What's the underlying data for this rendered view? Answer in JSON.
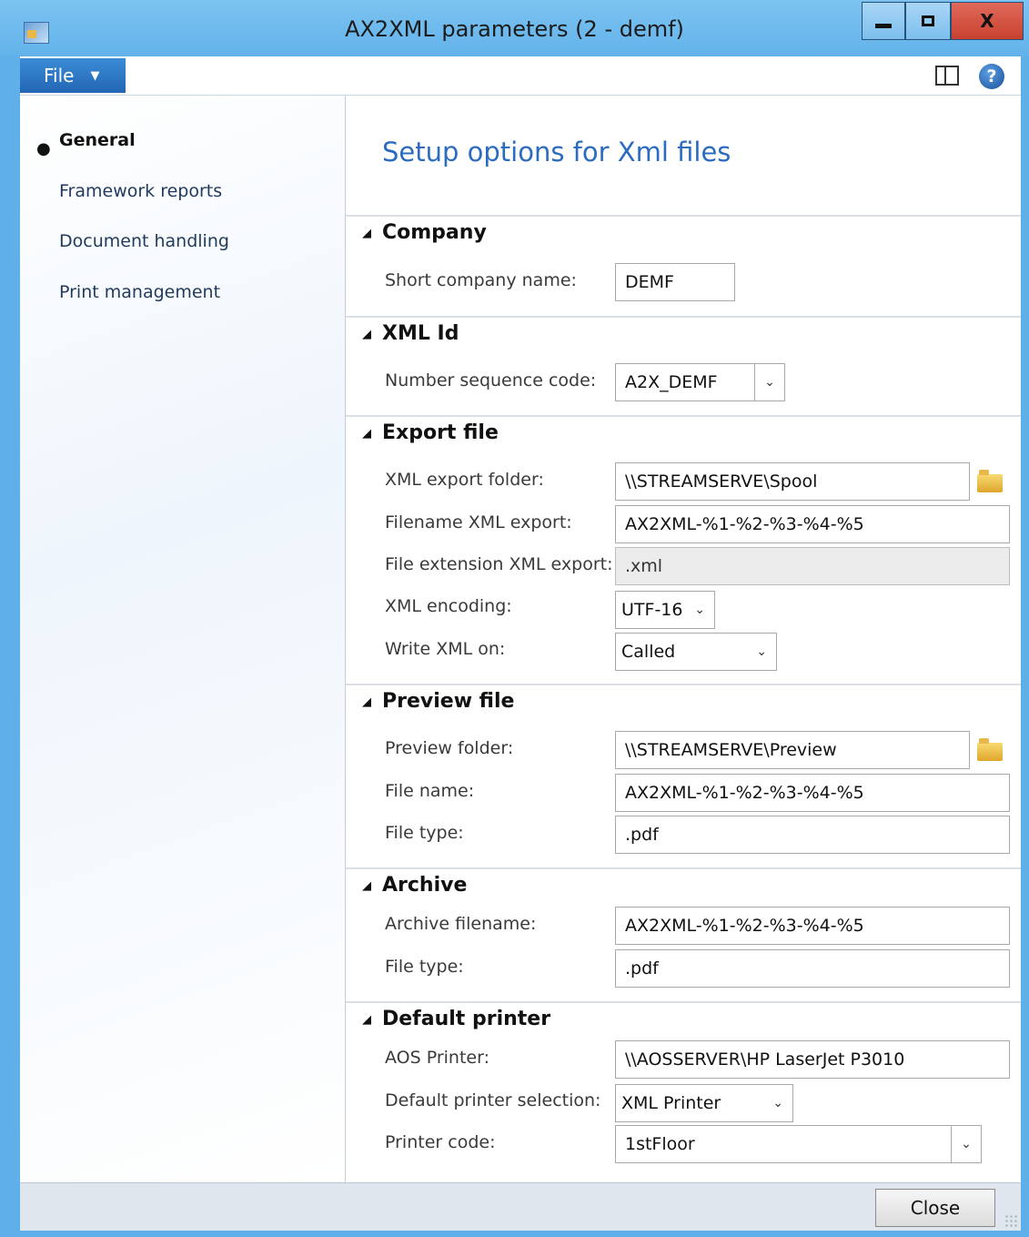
{
  "window": {
    "title": "AX2XML parameters (2 - demf)"
  },
  "ribbon": {
    "file_label": "File"
  },
  "nav": {
    "items": [
      {
        "label": "General",
        "active": true
      },
      {
        "label": "Framework reports"
      },
      {
        "label": "Document handling"
      },
      {
        "label": "Print management"
      }
    ]
  },
  "content": {
    "title": "Setup options for Xml files",
    "company": {
      "header": "Company",
      "short_name_label": "Short company name:",
      "short_name_value": "DEMF"
    },
    "xml_id": {
      "header": "XML Id",
      "number_sequence_label": "Number sequence code:",
      "number_sequence_value": "A2X_DEMF"
    },
    "export_file": {
      "header": "Export file",
      "folder_label": "XML export folder:",
      "folder_value": "\\\\STREAMSERVE\\Spool",
      "filename_label": "Filename XML export:",
      "filename_value": "AX2XML-%1-%2-%3-%4-%5",
      "extension_label": "File extension XML export:",
      "extension_value": ".xml",
      "encoding_label": "XML encoding:",
      "encoding_value": "UTF-16",
      "write_on_label": "Write XML on:",
      "write_on_value": "Called"
    },
    "preview_file": {
      "header": "Preview file",
      "folder_label": "Preview folder:",
      "folder_value": "\\\\STREAMSERVE\\Preview",
      "file_name_label": "File name:",
      "file_name_value": "AX2XML-%1-%2-%3-%4-%5",
      "file_type_label": "File type:",
      "file_type_value": ".pdf"
    },
    "archive": {
      "header": "Archive",
      "filename_label": "Archive filename:",
      "filename_value": "AX2XML-%1-%2-%3-%4-%5",
      "file_type_label": "File type:",
      "file_type_value": ".pdf"
    },
    "default_printer": {
      "header": "Default printer",
      "aos_label": "AOS Printer:",
      "aos_value": "\\\\AOSSERVER\\HP LaserJet P3010",
      "selection_label": "Default printer selection:",
      "selection_value": "XML Printer",
      "code_label": "Printer code:",
      "code_value": "1stFloor"
    }
  },
  "footer": {
    "close_label": "Close"
  },
  "colors": {
    "title_bar": "#62b2ea",
    "accent": "#2b6cc0",
    "file_button": "#2266b4",
    "close_button": "#c9402f"
  }
}
